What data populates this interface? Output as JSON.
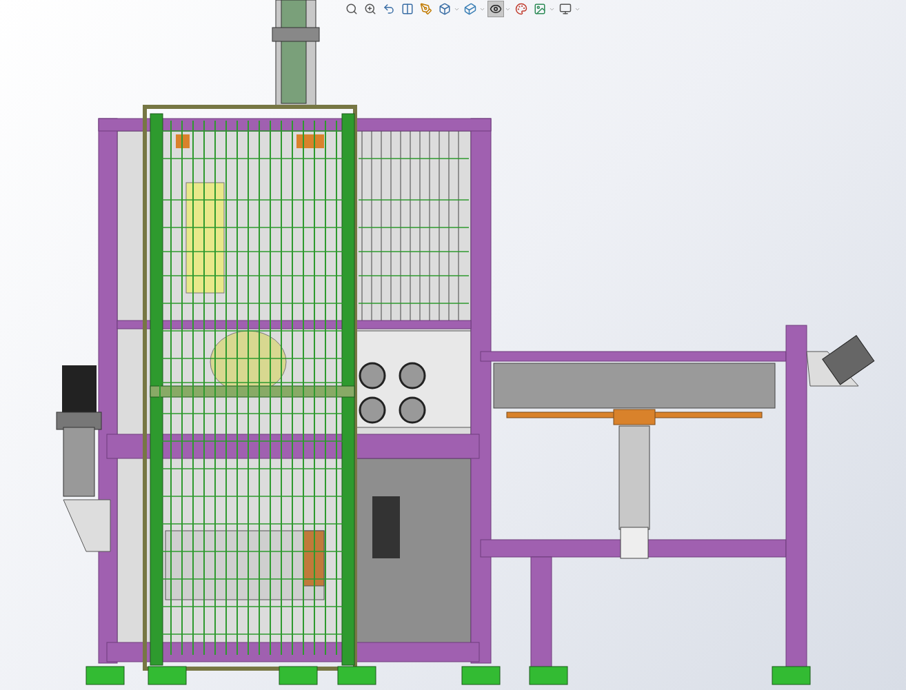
{
  "toolbar": [
    {
      "kind": "zoom-fit",
      "selected": false,
      "dropdown": false
    },
    {
      "kind": "zoom-area",
      "selected": false,
      "dropdown": false
    },
    {
      "kind": "previous-view",
      "selected": false,
      "dropdown": false
    },
    {
      "kind": "section-view",
      "selected": false,
      "dropdown": false
    },
    {
      "kind": "annotation-view",
      "selected": false,
      "dropdown": false
    },
    {
      "kind": "view-orientation",
      "selected": false,
      "dropdown": true
    },
    {
      "kind": "display-style",
      "selected": false,
      "dropdown": true
    },
    {
      "kind": "hide-show",
      "selected": true,
      "dropdown": true
    },
    {
      "kind": "edit-appearance",
      "selected": false,
      "dropdown": false
    },
    {
      "kind": "apply-scene",
      "selected": false,
      "dropdown": true
    },
    {
      "kind": "view-settings",
      "selected": false,
      "dropdown": true
    }
  ]
}
